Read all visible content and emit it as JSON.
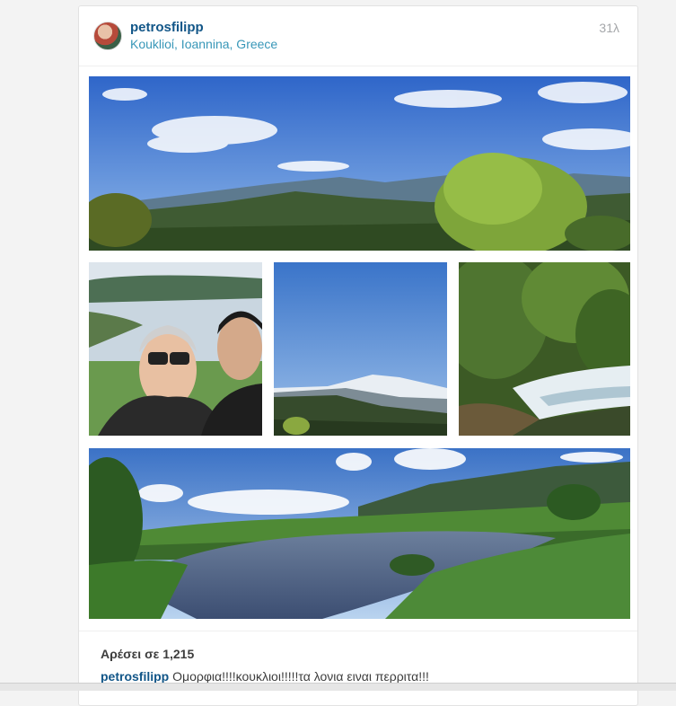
{
  "post": {
    "username": "petrosfilipp",
    "location": "Koukliοί, Ioannina, Greece",
    "timestamp": "31λ",
    "likes_text": "Αρέσει σε 1,215",
    "caption_user": "petrosfilipp",
    "caption_text": "Ομορφια!!!!κουκλιοι!!!!!τα λονια ειναι περριτα!!!"
  },
  "photos": [
    "mountain-panorama",
    "selfie-by-lake",
    "snowy-peak-sky",
    "river-rapids",
    "lake-panorama"
  ]
}
